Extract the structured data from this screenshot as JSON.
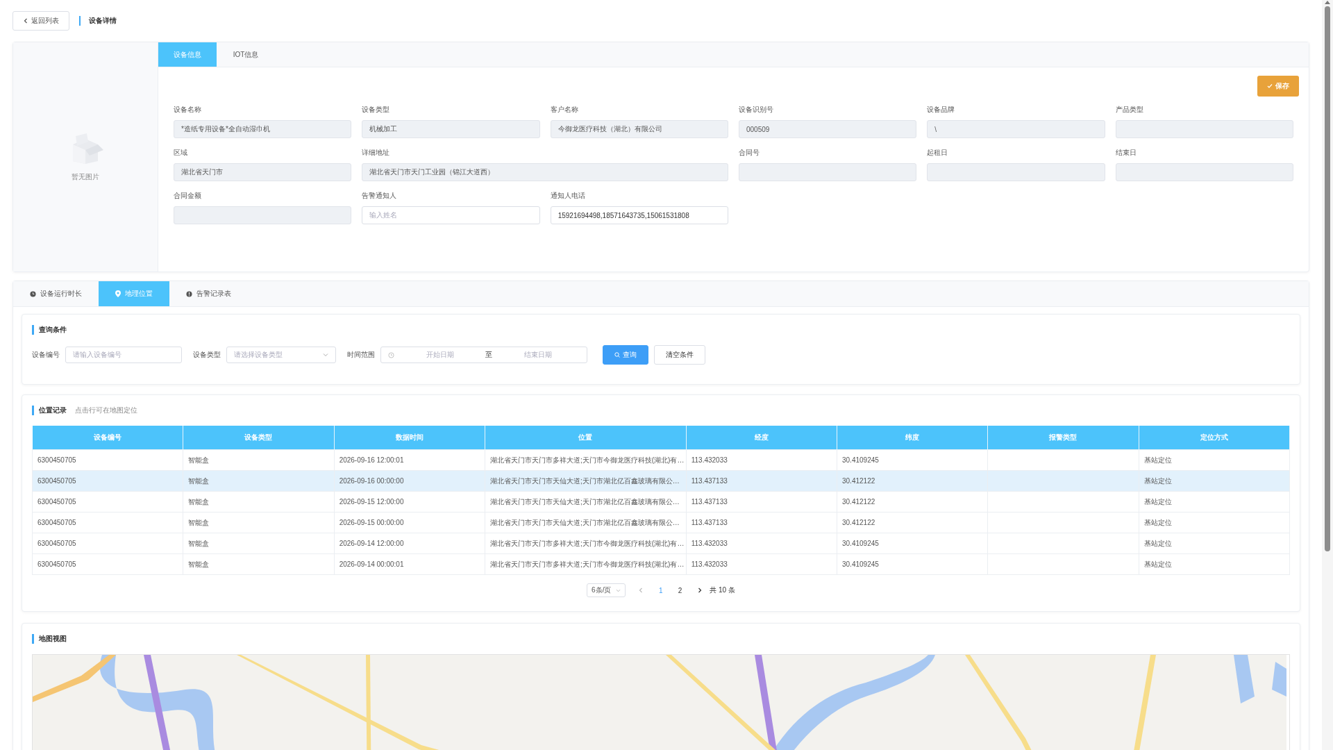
{
  "header": {
    "back_button": "返回列表",
    "title": "设备详情"
  },
  "device_card": {
    "image_placeholder": "暂无图片",
    "tabs": [
      {
        "label": "设备信息",
        "selected": true
      },
      {
        "label": "IOT信息",
        "selected": false
      }
    ],
    "save_button": "保存",
    "fields": [
      {
        "label": "设备名称",
        "value": "*造纸专用设备*全自动湿巾机",
        "disabled": true,
        "wide": false
      },
      {
        "label": "设备类型",
        "value": "机械加工",
        "disabled": true,
        "wide": false
      },
      {
        "label": "客户名称",
        "value": "今御龙医疗科技（湖北）有限公司",
        "disabled": true,
        "wide": false
      },
      {
        "label": "设备识别号",
        "value": "000509",
        "disabled": true,
        "wide": false
      },
      {
        "label": "设备品牌",
        "value": "\\",
        "disabled": true,
        "wide": false
      },
      {
        "label": "产品类型",
        "disabled": true,
        "wide": false
      },
      {
        "label": "区域",
        "value": "湖北省天门市",
        "disabled": true,
        "wide": false
      },
      {
        "label": "详细地址",
        "value": "湖北省天门市天门工业园（锦江大道西）",
        "disabled": true,
        "wide": true
      },
      {
        "label": "合同号",
        "disabled": true,
        "wide": false
      },
      {
        "label": "起租日",
        "disabled": true,
        "wide": false
      },
      {
        "label": "结束日",
        "disabled": true,
        "wide": false
      },
      {
        "label": "合同金额",
        "disabled": true,
        "wide": false
      },
      {
        "label": "告警通知人",
        "placeholder": "输入姓名",
        "disabled": false,
        "wide": false
      },
      {
        "label": "通知人电话",
        "value": "15921694498,18571643735,15061531808",
        "disabled": false,
        "wide": false
      }
    ]
  },
  "bottom_tabs": [
    {
      "label": "设备运行时长",
      "kind": "clock",
      "selected": false
    },
    {
      "label": "地理位置",
      "kind": "pin",
      "selected": true
    },
    {
      "label": "告警记录表",
      "kind": "alert",
      "selected": false
    }
  ],
  "query": {
    "title": "查询条件",
    "fields": [
      {
        "label": "设备编号",
        "kind": "text",
        "placeholder": "请输入设备编号"
      },
      {
        "label": "设备类型",
        "kind": "select",
        "placeholder": "请选择设备类型"
      },
      {
        "label": "时间范围",
        "kind": "daterange",
        "start_placeholder": "开始日期",
        "separator": "至",
        "end_placeholder": "结束日期"
      }
    ],
    "search_button": "查询",
    "clear_button": "清空条件"
  },
  "records": {
    "title": "位置记录",
    "hint": "点击行可在地图定位",
    "columns": [
      "设备编号",
      "设备类型",
      "数据时间",
      "位置",
      "经度",
      "纬度",
      "报警类型",
      "定位方式"
    ],
    "rows": [
      {
        "cells": [
          "6300450705",
          "智能盒",
          "2026-09-16 12:00:01",
          "湖北省天门市天门市多祥大道;天门市今御龙医疗科技(湖北)有…",
          "113.432033",
          "30.4109245",
          "",
          "基站定位"
        ],
        "selected": false
      },
      {
        "cells": [
          "6300450705",
          "智能盒",
          "2026-09-16 00:00:00",
          "湖北省天门市天门市天仙大道;天门市湖北亿百鑫玻璃有限公…",
          "113.437133",
          "30.412122",
          "",
          "基站定位"
        ],
        "selected": true
      },
      {
        "cells": [
          "6300450705",
          "智能盒",
          "2026-09-15 12:00:00",
          "湖北省天门市天门市天仙大道;天门市湖北亿百鑫玻璃有限公…",
          "113.437133",
          "30.412122",
          "",
          "基站定位"
        ],
        "selected": false
      },
      {
        "cells": [
          "6300450705",
          "智能盒",
          "2026-09-15 00:00:00",
          "湖北省天门市天门市天仙大道;天门市湖北亿百鑫玻璃有限公…",
          "113.437133",
          "30.412122",
          "",
          "基站定位"
        ],
        "selected": false
      },
      {
        "cells": [
          "6300450705",
          "智能盒",
          "2026-09-14 12:00:00",
          "湖北省天门市天门市多祥大道;天门市今御龙医疗科技(湖北)有…",
          "113.432033",
          "30.4109245",
          "",
          "基站定位"
        ],
        "selected": false
      },
      {
        "cells": [
          "6300450705",
          "智能盒",
          "2026-09-14 00:00:01",
          "湖北省天门市天门市多祥大道;天门市今御龙医疗科技(湖北)有…",
          "113.432033",
          "30.4109245",
          "",
          "基站定位"
        ],
        "selected": false
      }
    ],
    "pagination": {
      "page_size": "6条/页",
      "pages": [
        {
          "label": "1",
          "selected": true
        },
        {
          "label": "2",
          "selected": false
        }
      ],
      "total": "共 10 条"
    }
  },
  "map": {
    "title": "地图视图",
    "kind": "picture"
  }
}
